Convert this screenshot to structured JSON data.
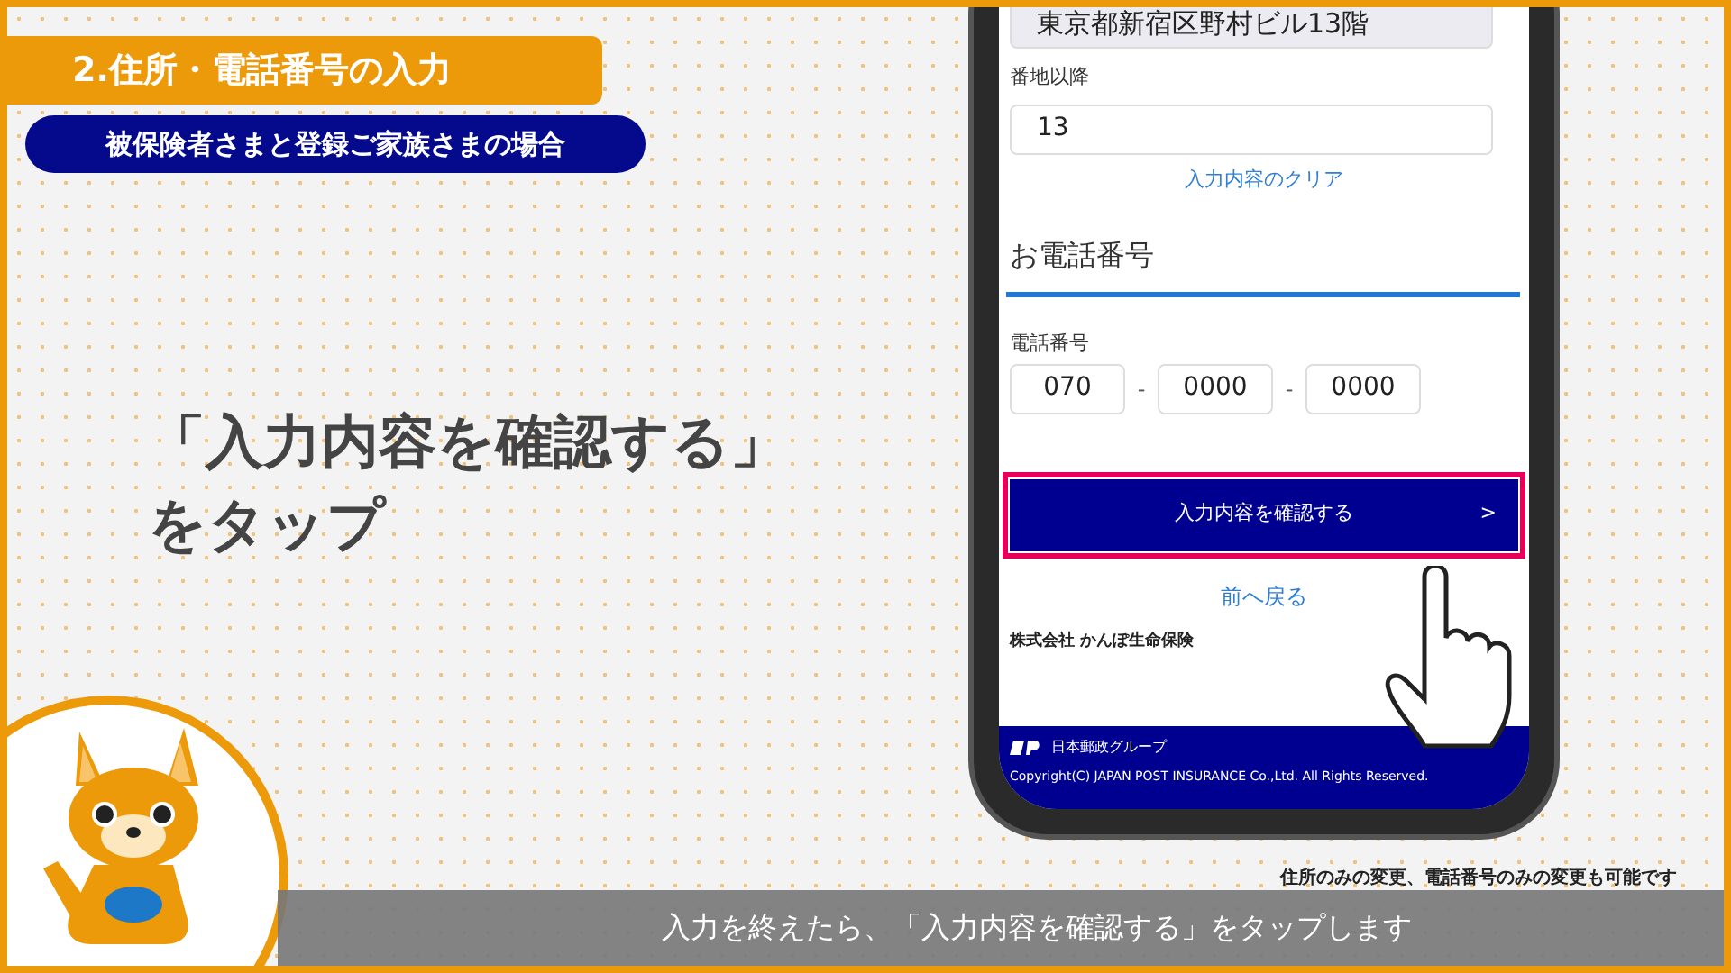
{
  "title": "2.住所・電話番号の入力",
  "subtitle": "被保険者さまと登録ご家族さまの場合",
  "instruction": [
    "「入力内容を確認する」",
    "をタップ"
  ],
  "phone": {
    "address": "東京都新宿区野村ビル13階",
    "address_detail_label": "番地以降",
    "address_detail_value": "13",
    "clear_link": "入力内容のクリア",
    "section_heading": "お電話番号",
    "phone_label": "電話番号",
    "phone_parts": [
      "070",
      "0000",
      "0000"
    ],
    "separators": [
      "-",
      "-"
    ],
    "confirm_button": "入力内容を確認する",
    "confirm_arrow": ">",
    "back_link": "前へ戻る",
    "company": "株式会社 かんぽ生命保険",
    "group_name": "日本郵政グループ",
    "copyright": "Copyright(C) JAPAN POST INSURANCE Co.,Ltd. All Rights Reserved."
  },
  "note": "住所のみの変更、電話番号のみの変更も可能です",
  "caption": "入力を終えたら、「入力内容を確認する」をタップします"
}
